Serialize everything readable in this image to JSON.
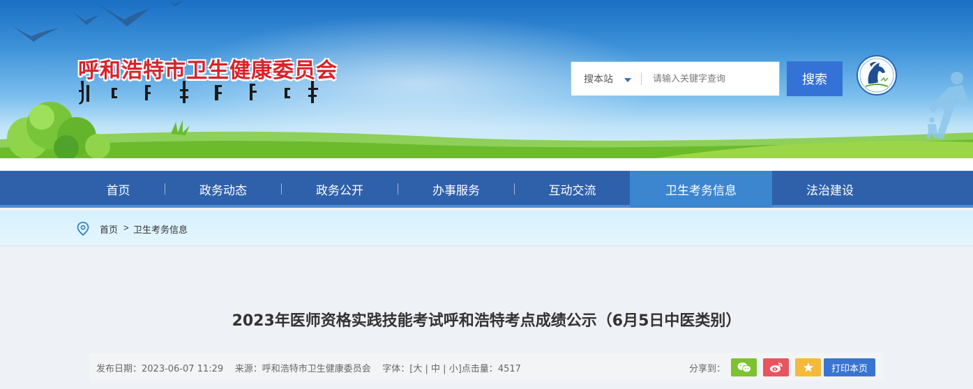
{
  "header": {
    "org_name_cn": "呼和浩特市卫生健康委员会",
    "org_name_mn_alt": "ᠬᠥᠬᠡᠬᠣᠲᠠ ᠶᠢᠨ ᠡᠷᠡᠭᠦᠯ ᠮᠡᠨᠳᠦ",
    "search": {
      "scope_label": "搜本站",
      "placeholder": "请输入关键字查询",
      "button_label": "搜索"
    },
    "emblem_icon": "horse-emblem-icon",
    "colors": {
      "brand_red": "#d8232a",
      "accent_blue": "#3572d6"
    }
  },
  "nav": {
    "items": [
      {
        "label": "首页",
        "active": false
      },
      {
        "label": "政务动态",
        "active": false
      },
      {
        "label": "政务公开",
        "active": false
      },
      {
        "label": "办事服务",
        "active": false
      },
      {
        "label": "互动交流",
        "active": false
      },
      {
        "label": "卫生考务信息",
        "active": true
      },
      {
        "label": "法治建设",
        "active": false
      }
    ],
    "colors": {
      "bar": "#2f61aa",
      "active": "#3c86d0"
    }
  },
  "breadcrumb": {
    "icon": "location-pin-icon",
    "home": "首页",
    "separator": ">",
    "current": "卫生考务信息"
  },
  "article": {
    "title": "2023年医师资格实践技能考试呼和浩特考点成绩公示（6月5日中医类别）",
    "meta": {
      "date_label": "发布日期：",
      "date": "2023-06-07 11:29",
      "source_label": "来源：",
      "source": "呼和浩特市卫生健康委员会",
      "font_label": "字体：",
      "font_open": "[",
      "font_large": "大",
      "font_sep1": " | ",
      "font_medium": "中",
      "font_sep2": " | ",
      "font_small": "小",
      "font_close": "]",
      "views_label": "点击量：",
      "views": "4517"
    },
    "share": {
      "label": "分享到：",
      "wechat_icon": "wechat-icon",
      "weibo_icon": "weibo-icon",
      "favorite_icon": "star-icon",
      "print_label": "打印本页",
      "colors": {
        "wechat": "#7dc22f",
        "weibo": "#e9545f",
        "favorite": "#f5b93a",
        "print": "#3a75d1"
      }
    }
  }
}
